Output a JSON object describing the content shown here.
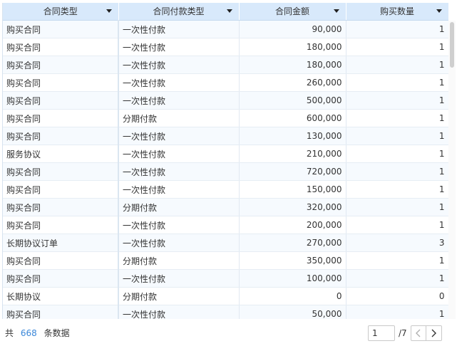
{
  "table": {
    "columns": [
      {
        "label": "合同类型"
      },
      {
        "label": "合同付款类型"
      },
      {
        "label": "合同金额"
      },
      {
        "label": "购买数量"
      }
    ],
    "rows": [
      [
        "购买合同",
        "一次性付款",
        "90,000",
        "1"
      ],
      [
        "购买合同",
        "一次性付款",
        "180,000",
        "1"
      ],
      [
        "购买合同",
        "一次性付款",
        "180,000",
        "1"
      ],
      [
        "购买合同",
        "一次性付款",
        "260,000",
        "1"
      ],
      [
        "购买合同",
        "一次性付款",
        "500,000",
        "1"
      ],
      [
        "购买合同",
        "分期付款",
        "600,000",
        "1"
      ],
      [
        "购买合同",
        "一次性付款",
        "130,000",
        "1"
      ],
      [
        "服务协议",
        "一次性付款",
        "210,000",
        "1"
      ],
      [
        "购买合同",
        "一次性付款",
        "720,000",
        "1"
      ],
      [
        "购买合同",
        "一次性付款",
        "150,000",
        "1"
      ],
      [
        "购买合同",
        "分期付款",
        "320,000",
        "1"
      ],
      [
        "购买合同",
        "一次性付款",
        "200,000",
        "1"
      ],
      [
        "长期协议订单",
        "一次性付款",
        "270,000",
        "3"
      ],
      [
        "购买合同",
        "分期付款",
        "350,000",
        "1"
      ],
      [
        "购买合同",
        "一次性付款",
        "100,000",
        "1"
      ],
      [
        "长期协议",
        "分期付款",
        "0",
        "0"
      ],
      [
        "购买合同",
        "一次性付款",
        "50,000",
        "1"
      ]
    ]
  },
  "footer": {
    "prefix": "共",
    "count": "668",
    "suffix": "条数据"
  },
  "pager": {
    "current_page": "1",
    "total_pages": "/7"
  },
  "colors": {
    "header_bg": "#d8e9fb",
    "row_alt_bg": "#f6fafe",
    "count_color": "#3b87d8"
  },
  "icons": {
    "header_dropdown": "caret-down-icon",
    "prev": "chevron-left-icon",
    "next": "chevron-right-icon"
  }
}
